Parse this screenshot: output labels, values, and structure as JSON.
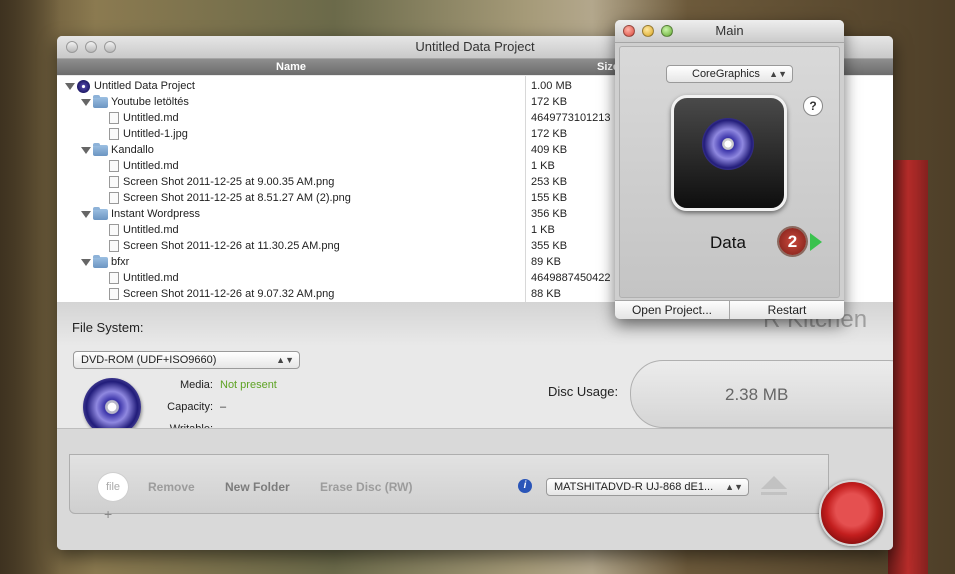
{
  "main_window": {
    "title": "Untitled Data Project",
    "columns": {
      "name": "Name",
      "size": "Size"
    },
    "rows": [
      {
        "name": "Untitled Data Project",
        "size": "1.00 MB",
        "kind": "disc",
        "expanded": true
      },
      {
        "name": "Youtube letöltés",
        "size": "172 KB",
        "kind": "folder",
        "expanded": true
      },
      {
        "name": "Untitled.md",
        "size": "4649773101213",
        "kind": "file"
      },
      {
        "name": "Untitled-1.jpg",
        "size": "172 KB",
        "kind": "file"
      },
      {
        "name": "Kandallo",
        "size": "409 KB",
        "kind": "folder",
        "expanded": true
      },
      {
        "name": "Untitled.md",
        "size": "1 KB",
        "kind": "file"
      },
      {
        "name": "Screen Shot 2011-12-25 at 9.00.35 AM.png",
        "size": "253 KB",
        "kind": "file"
      },
      {
        "name": "Screen Shot 2011-12-25 at 8.51.27 AM (2).png",
        "size": "155 KB",
        "kind": "file"
      },
      {
        "name": "Instant Wordpress",
        "size": "356 KB",
        "kind": "folder",
        "expanded": true
      },
      {
        "name": "Untitled.md",
        "size": "1 KB",
        "kind": "file"
      },
      {
        "name": "Screen Shot 2011-12-26 at 11.30.25 AM.png",
        "size": "355 KB",
        "kind": "file"
      },
      {
        "name": "bfxr",
        "size": "89 KB",
        "kind": "folder",
        "expanded": true
      },
      {
        "name": "Untitled.md",
        "size": "4649887450422",
        "kind": "file"
      },
      {
        "name": "Screen Shot 2011-12-26 at 9.07.32 AM.png",
        "size": "88 KB",
        "kind": "file"
      }
    ],
    "file_system": {
      "label": "File System:",
      "selected": "DVD-ROM (UDF+ISO9660)",
      "media_label": "Media:",
      "media_value": "Not present",
      "capacity_label": "Capacity:",
      "capacity_value": "–",
      "writable_label": "Writable:",
      "writable_value": "–"
    },
    "background_text": "R Kitchen",
    "disc_usage": {
      "label": "Disc Usage:",
      "value": "2.38 MB"
    },
    "toolbar": {
      "add_file_label": "file",
      "add_plus": "+",
      "remove_label": "Remove",
      "new_folder_label": "New Folder",
      "erase_disc_label": "Erase Disc (RW)",
      "info_glyph": "i",
      "drive_selected": "MATSHITADVD-R   UJ-868  dE1..."
    }
  },
  "side_panel": {
    "title": "Main",
    "renderer_selected": "CoreGraphics",
    "help_glyph": "?",
    "project_type": "Data",
    "badge_count": "2",
    "open_project_label": "Open Project...",
    "restart_label": "Restart"
  },
  "colors": {
    "media_value": "#5ea324",
    "header_bar": "#7b7b7b",
    "burn_button": "#c31e1e",
    "badge": "#a0322a",
    "arrow": "#3ac24e"
  }
}
